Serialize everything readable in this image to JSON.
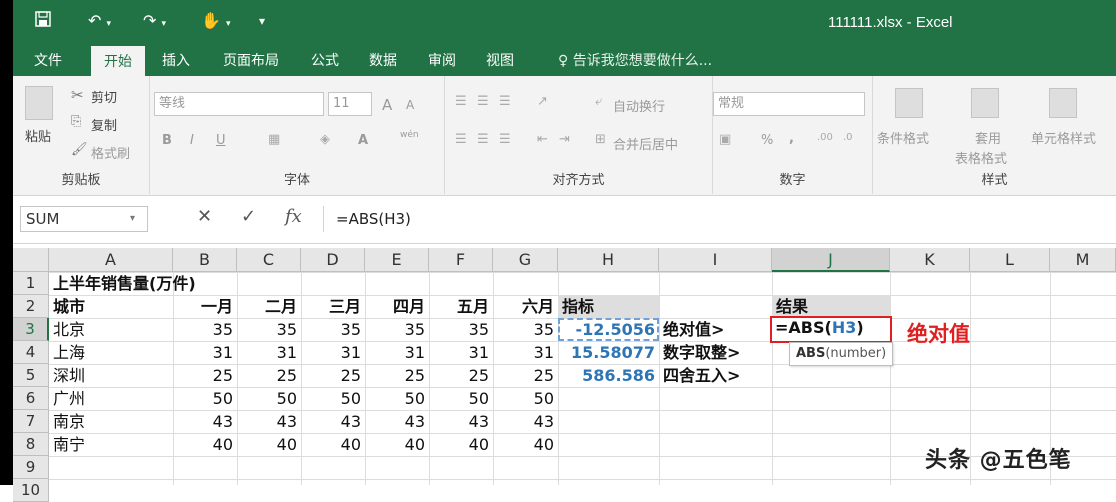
{
  "window": {
    "title": "111111.xlsx - Excel",
    "qa_save_icon": "save-icon",
    "qa_undo_icon": "undo-icon",
    "qa_redo_icon": "redo-icon",
    "qa_touch_icon": "touch-mode-icon"
  },
  "tabs": [
    {
      "label": "文件"
    },
    {
      "label": "开始",
      "active": true
    },
    {
      "label": "插入"
    },
    {
      "label": "页面布局"
    },
    {
      "label": "公式"
    },
    {
      "label": "数据"
    },
    {
      "label": "审阅"
    },
    {
      "label": "视图"
    }
  ],
  "tell_me": "♀ 告诉我您想要做什么...",
  "ribbon": {
    "clipboard": {
      "label": "剪贴板",
      "paste": "粘贴",
      "cut": "剪切",
      "copy": "复制",
      "format_painter": "格式刷"
    },
    "font": {
      "label": "字体",
      "font_name": "等线",
      "font_size": "11",
      "grow": "A",
      "shrink": "A",
      "bold": "B",
      "italic": "I",
      "underline": "U",
      "font_color": "A",
      "wen": "wén"
    },
    "alignment": {
      "label": "对齐方式",
      "wrap": "自动换行",
      "merge": "合并后居中"
    },
    "number": {
      "label": "数字",
      "format": "常规",
      "percent": "%",
      "comma": ","
    },
    "styles": {
      "label": "样式",
      "conditional": "条件格式",
      "table1": "套用",
      "table2": "表格格式",
      "cell_styles": "单元格样式"
    }
  },
  "formula_bar": {
    "name_box": "SUM",
    "cancel": "✕",
    "enter": "✓",
    "fx": "fx",
    "formula": "=ABS(H3)"
  },
  "columns": [
    "A",
    "B",
    "C",
    "D",
    "E",
    "F",
    "G",
    "H",
    "I",
    "J",
    "K",
    "L",
    "M"
  ],
  "rows": [
    "1",
    "2",
    "3",
    "4",
    "5",
    "6",
    "7",
    "8",
    "9",
    "10"
  ],
  "cells": {
    "A1": "上半年销售量(万件)",
    "A2": "城市",
    "B2": "一月",
    "C2": "二月",
    "D2": "三月",
    "E2": "四月",
    "F2": "五月",
    "G2": "六月",
    "H2": "指标",
    "J2": "结果",
    "A3": "北京",
    "B3": "35",
    "C3": "35",
    "D3": "35",
    "E3": "35",
    "F3": "35",
    "G3": "35",
    "H3": "-12.5056",
    "I3": "绝对值>",
    "A4": "上海",
    "B4": "31",
    "C4": "31",
    "D4": "31",
    "E4": "31",
    "F4": "31",
    "G4": "31",
    "H4": "15.58077",
    "I4": "数字取整>",
    "A5": "深圳",
    "B5": "25",
    "C5": "25",
    "D5": "25",
    "E5": "25",
    "F5": "25",
    "G5": "25",
    "H5": "586.586",
    "I5": "四舍五入>",
    "A6": "广州",
    "B6": "50",
    "C6": "50",
    "D6": "50",
    "E6": "50",
    "F6": "50",
    "G6": "50",
    "A7": "南京",
    "B7": "43",
    "C7": "43",
    "D7": "43",
    "E7": "43",
    "F7": "43",
    "G7": "43",
    "A8": "南宁",
    "B8": "40",
    "C8": "40",
    "D8": "40",
    "E8": "40",
    "F8": "40",
    "G8": "40"
  },
  "edit_cell": {
    "prefix": "=ABS(",
    "ref": "H3",
    "suffix": ")"
  },
  "tooltip": {
    "func": "ABS",
    "args": "(number)"
  },
  "annotation": "绝对值",
  "watermark": "头条 @五色笔",
  "colors": {
    "accent": "#217346",
    "annotation_red": "#e02020",
    "link_blue": "#2e75b6"
  }
}
